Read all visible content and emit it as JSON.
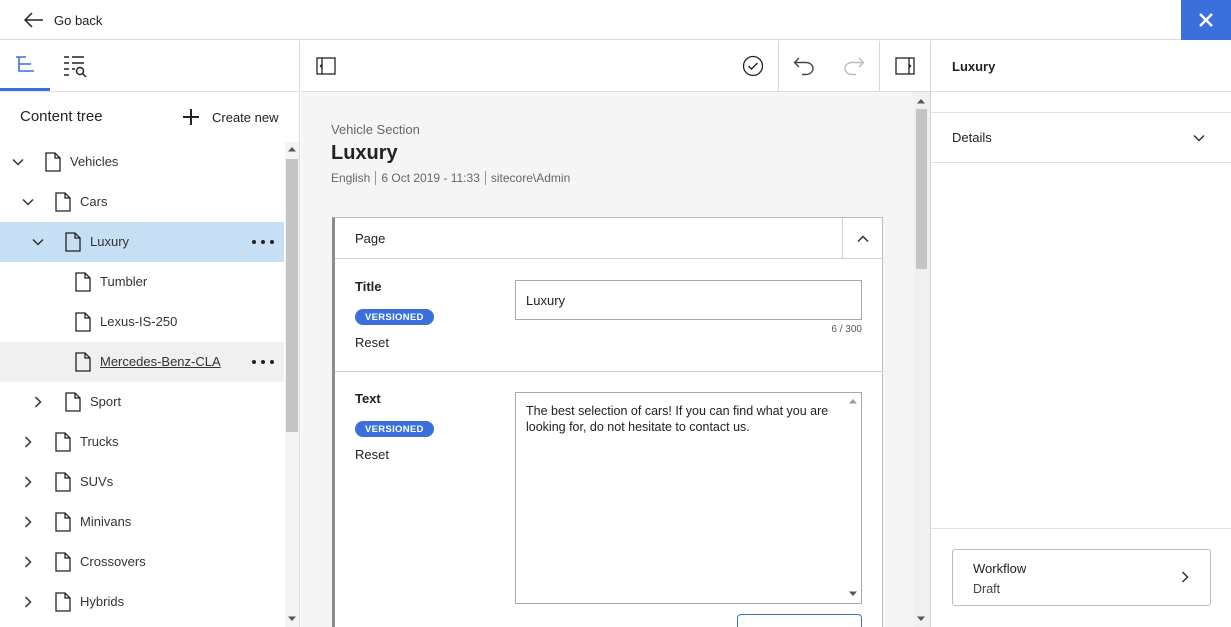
{
  "topbar": {
    "go_back": "Go back"
  },
  "colors": {
    "accent": "#3b6fdc",
    "selected_row": "#c6dff5",
    "hover_row": "#f0f0f0"
  },
  "left_panel": {
    "tabs": [
      {
        "icon": "content-tree-icon",
        "active": true
      },
      {
        "icon": "search-list-icon",
        "active": false
      }
    ],
    "title": "Content tree",
    "create_new": "Create new",
    "tree": [
      {
        "label": "Vehicles",
        "expanded": true
      },
      {
        "label": "Cars",
        "expanded": true
      },
      {
        "label": "Luxury",
        "expanded": true,
        "selected": true
      },
      {
        "label": "Tumbler"
      },
      {
        "label": "Lexus-IS-250"
      },
      {
        "label": "Mercedes-Benz-CLA",
        "hovered": true
      },
      {
        "label": "Sport",
        "expanded": false
      },
      {
        "label": "Trucks",
        "expanded": false
      },
      {
        "label": "SUVs",
        "expanded": false
      },
      {
        "label": "Minivans",
        "expanded": false
      },
      {
        "label": "Crossovers",
        "expanded": false
      },
      {
        "label": "Hybrids",
        "expanded": false
      }
    ]
  },
  "editor": {
    "item_type": "Vehicle Section",
    "item_title": "Luxury",
    "meta": {
      "language": "English",
      "date": "6 Oct 2019 - 11:33",
      "user": "sitecore\\Admin"
    },
    "section": {
      "label": "Page",
      "fields": {
        "title": {
          "label": "Title",
          "badge": "VERSIONED",
          "reset": "Reset",
          "value": "Luxury",
          "count": "6 / 300"
        },
        "text": {
          "label": "Text",
          "badge": "VERSIONED",
          "reset": "Reset",
          "value": "The best selection of cars! If you can find what you are looking for, do not hesitate to contact us."
        }
      }
    }
  },
  "right_panel": {
    "title": "Luxury",
    "details": "Details",
    "workflow": {
      "label": "Workflow",
      "value": "Draft"
    }
  }
}
